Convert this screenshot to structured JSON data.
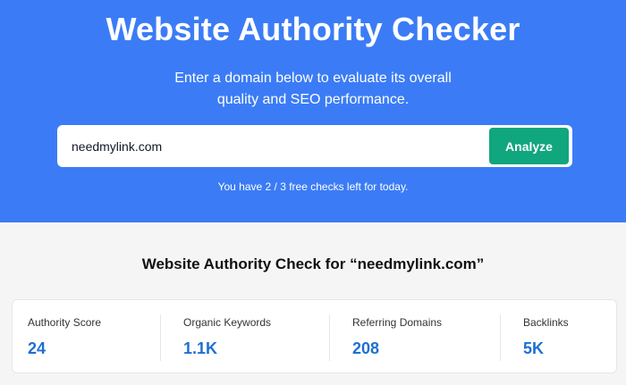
{
  "hero": {
    "title": "Website Authority Checker",
    "subtitle_line1": "Enter a domain below to evaluate its overall",
    "subtitle_line2": "quality and SEO performance.",
    "search": {
      "value": "needmylink.com",
      "placeholder": ""
    },
    "analyze_label": "Analyze",
    "checks_note": "You have 2 / 3 free checks left for today."
  },
  "results": {
    "title": "Website Authority Check for “needmylink.com”",
    "metrics": [
      {
        "label": "Authority Score",
        "value": "24"
      },
      {
        "label": "Organic Keywords",
        "value": "1.1K"
      },
      {
        "label": "Referring Domains",
        "value": "208"
      },
      {
        "label": "Backlinks",
        "value": "5K"
      }
    ]
  },
  "colors": {
    "hero_bg": "#3b7cf6",
    "button": "#10a67e",
    "metric_value": "#1f6fd1"
  }
}
